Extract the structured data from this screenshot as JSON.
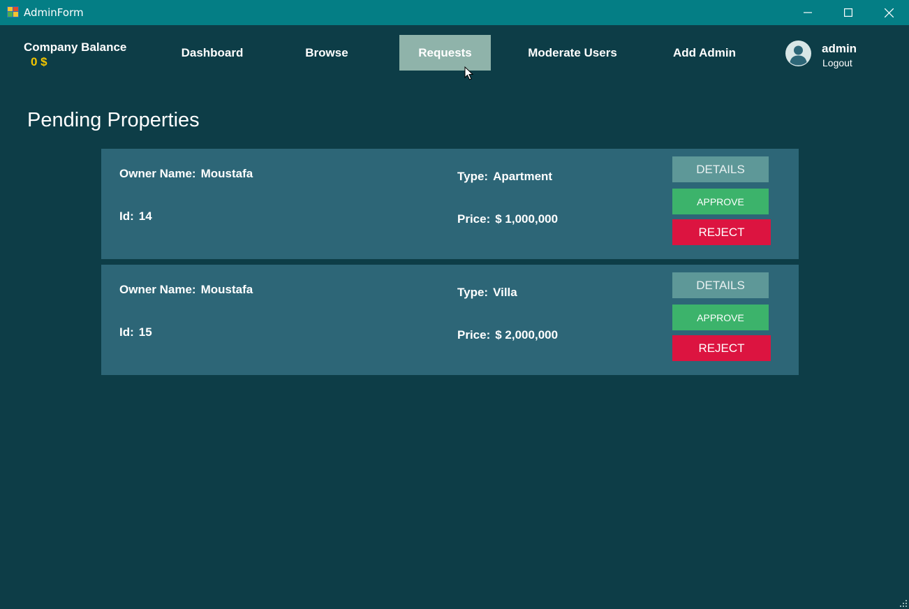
{
  "window": {
    "title": "AdminForm"
  },
  "header": {
    "balance_label": "Company Balance",
    "balance_value": "0 $",
    "nav": [
      {
        "label": "Dashboard"
      },
      {
        "label": "Browse"
      },
      {
        "label": "Requests",
        "active": true
      },
      {
        "label": "Moderate Users"
      },
      {
        "label": "Add Admin"
      }
    ],
    "user": {
      "name": "admin",
      "logout_label": "Logout"
    }
  },
  "main": {
    "title": "Pending Properties",
    "labels": {
      "owner": "Owner Name:",
      "id": "Id:",
      "type": "Type:",
      "price": "Price:"
    },
    "buttons": {
      "details": "DETAILS",
      "approve": "APPROVE",
      "reject": "REJECT"
    },
    "properties": [
      {
        "owner": "Moustafa",
        "id": "14",
        "type": "Apartment",
        "price": "$ 1,000,000"
      },
      {
        "owner": "Moustafa",
        "id": "15",
        "type": "Villa",
        "price": "$ 2,000,000"
      }
    ]
  },
  "colors": {
    "titlebar": "#047e85",
    "background": "#0d3d47",
    "card": "#2d6677",
    "active_nav": "#8fb3aa",
    "balance": "#f2c500",
    "details": "#5e9898",
    "approve": "#3cb36b",
    "reject": "#dc1440"
  },
  "icons": [
    "app-icon",
    "minimize-icon",
    "maximize-icon",
    "close-icon",
    "user-avatar-icon",
    "mouse-cursor-icon",
    "resize-grip-icon"
  ]
}
